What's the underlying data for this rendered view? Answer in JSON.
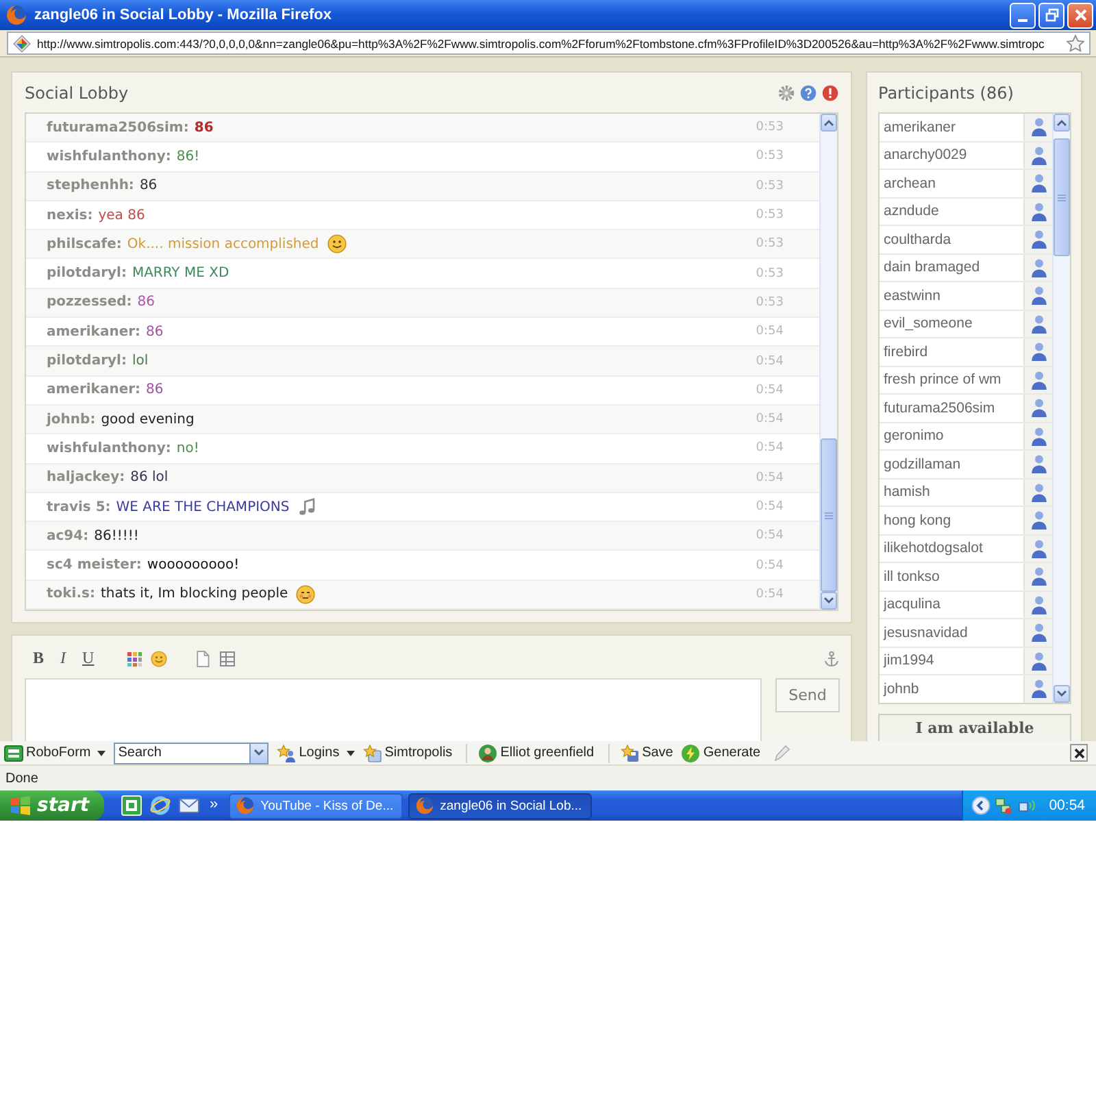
{
  "window": {
    "title": "zangle06 in Social Lobby - Mozilla Firefox"
  },
  "address_bar": {
    "url": "http://www.simtropolis.com:443/?0,0,0,0,0&nn=zangle06&pu=http%3A%2F%2Fwww.simtropolis.com%2Fforum%2Ftombstone.cfm%3FProfileID%3D200526&au=http%3A%2F%2Fwww.simtropc"
  },
  "chat": {
    "title": "Social Lobby",
    "messages": [
      {
        "user": "futurama2506sim:",
        "text": "86",
        "time": "0:53",
        "color": "#b8282c",
        "bold": true,
        "kind": "plain"
      },
      {
        "user": "wishfulanthony:",
        "text": "86!",
        "time": "0:53",
        "color": "#4d8a4d",
        "bold": false,
        "kind": "plain"
      },
      {
        "user": "stephenhh:",
        "text": "86",
        "time": "0:53",
        "color": "#333333",
        "bold": false,
        "kind": "plain"
      },
      {
        "user": "nexis:",
        "text": "yea 86",
        "time": "0:53",
        "color": "#c04a4a",
        "bold": false,
        "kind": "plain"
      },
      {
        "user": "philscafe:",
        "text": "Ok.... mission accomplished",
        "time": "0:53",
        "color": "#d39a3a",
        "bold": false,
        "kind": "smile"
      },
      {
        "user": "pilotdaryl:",
        "text": "MARRY ME XD",
        "time": "0:53",
        "color": "#3c8a5c",
        "bold": false,
        "kind": "plain"
      },
      {
        "user": "pozzessed:",
        "text": "86",
        "time": "0:53",
        "color": "#b050b0",
        "bold": false,
        "kind": "plain"
      },
      {
        "user": "amerikaner:",
        "text": "86",
        "time": "0:54",
        "color": "#a050a0",
        "bold": false,
        "kind": "plain"
      },
      {
        "user": "pilotdaryl:",
        "text": "lol",
        "time": "0:54",
        "color": "#4a7a4a",
        "bold": false,
        "kind": "plain"
      },
      {
        "user": "amerikaner:",
        "text": "86",
        "time": "0:54",
        "color": "#a050a0",
        "bold": false,
        "kind": "plain"
      },
      {
        "user": "johnb:",
        "text": "good evening",
        "time": "0:54",
        "color": "#222222",
        "bold": false,
        "kind": "plain"
      },
      {
        "user": "wishfulanthony:",
        "text": "no!",
        "time": "0:54",
        "color": "#4d8a4d",
        "bold": false,
        "kind": "plain"
      },
      {
        "user": "haljackey:",
        "text": "86 lol",
        "time": "0:54",
        "color": "#333355",
        "bold": false,
        "kind": "plain"
      },
      {
        "user": "travis 5:",
        "text": "WE ARE THE CHAMPIONS",
        "time": "0:54",
        "color": "#3a3aa0",
        "bold": false,
        "kind": "note"
      },
      {
        "user": "ac94:",
        "text": "86!!!!!",
        "time": "0:54",
        "color": "#222222",
        "bold": false,
        "kind": "plain"
      },
      {
        "user": "sc4 meister:",
        "text": "wooooooooo!",
        "time": "0:54",
        "color": "#111111",
        "bold": false,
        "kind": "plain"
      },
      {
        "user": "toki.s:",
        "text": "thats it, Im blocking people",
        "time": "0:54",
        "color": "#222222",
        "bold": false,
        "kind": "blush"
      }
    ]
  },
  "composer": {
    "format_buttons": [
      "B",
      "I",
      "U"
    ],
    "send_button": "Send"
  },
  "participants": {
    "title": "Participants (86)",
    "names": [
      "amerikaner",
      "anarchy0029",
      "archean",
      "azndude",
      "coultharda",
      "dain bramaged",
      "eastwinn",
      "evil_someone",
      "firebird",
      "fresh prince of wm",
      "futurama2506sim",
      "geronimo",
      "godzillaman",
      "hamish",
      "hong kong",
      "ilikehotdogsalot",
      "ill tonkso",
      "jacqulina",
      "jesusnavidad",
      "jim1994",
      "johnb"
    ],
    "status_button": "I am available"
  },
  "roboform": {
    "menu": "RoboForm",
    "search": {
      "placeholder": "Search"
    },
    "buttons": [
      {
        "kind": "logins",
        "label": "Logins",
        "dropdown": true
      },
      {
        "kind": "passcard",
        "label": "Simtropolis",
        "dropdown": false
      },
      {
        "kind": "identity",
        "label": "Elliot greenfield",
        "dropdown": false
      },
      {
        "kind": "save",
        "label": "Save",
        "dropdown": false
      },
      {
        "kind": "generate",
        "label": "Generate",
        "dropdown": false
      }
    ]
  },
  "status_bar": {
    "text": "Done"
  },
  "taskbar": {
    "start": "start",
    "more": "»",
    "tasks": [
      {
        "label": "YouTube - Kiss of De...",
        "selected": false
      },
      {
        "label": "zangle06 in Social Lob...",
        "selected": true
      }
    ],
    "clock": "00:54"
  }
}
